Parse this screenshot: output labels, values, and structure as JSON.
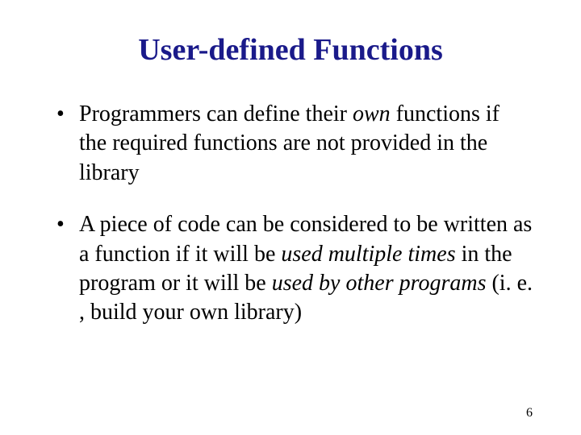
{
  "title": "User-defined Functions",
  "bullets": {
    "b1": {
      "t1": "Programmers can define their ",
      "t2": "own",
      "t3": " functions if the required functions are not provided in the library"
    },
    "b2": {
      "t1": "A piece of code can be considered to be written as a function if it will be ",
      "t2": "used multiple times",
      "t3": " in the program or it will be ",
      "t4": "used by other programs",
      "t5": " (i. e. , build your own library)"
    }
  },
  "page_number": "6"
}
